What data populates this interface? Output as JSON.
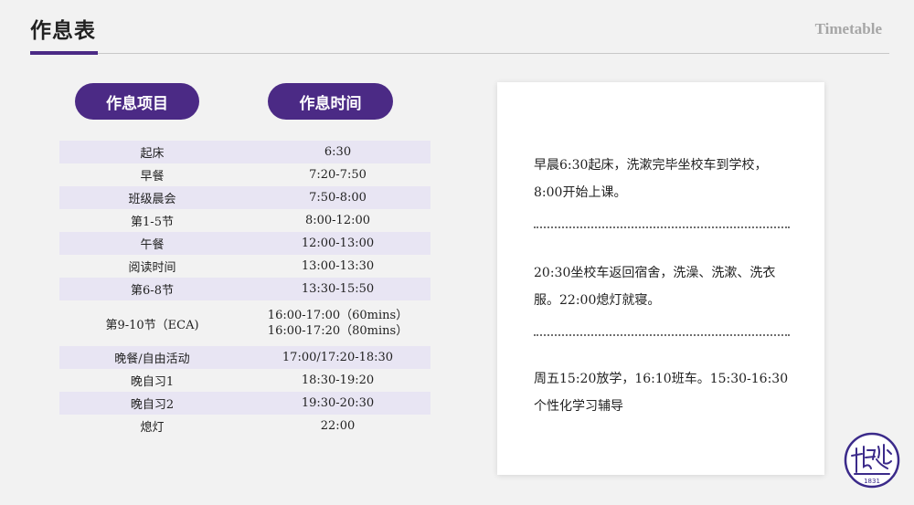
{
  "header": {
    "title": "作息表",
    "subtitle": "Timetable"
  },
  "columns": {
    "item": "作息项目",
    "time": "作息时间"
  },
  "schedule": [
    {
      "item": "起床",
      "time": "6:30"
    },
    {
      "item": "早餐",
      "time": "7:20-7:50"
    },
    {
      "item": "班级晨会",
      "time": "7:50-8:00"
    },
    {
      "item": "第1-5节",
      "time": "8:00-12:00"
    },
    {
      "item": "午餐",
      "time": "12:00-13:00"
    },
    {
      "item": "阅读时间",
      "time": "13:00-13:30"
    },
    {
      "item": "第6-8节",
      "time": "13:30-15:50"
    },
    {
      "item": "第9-10节（ECA)",
      "time": "16:00-17:00（60mins）",
      "time2": "16:00-17:20（80mins）"
    },
    {
      "item": "晚餐/自由活动",
      "time": "17:00/17:20-18:30"
    },
    {
      "item": "晚自习1",
      "time": "18:30-19:20"
    },
    {
      "item": "晚自习2",
      "time": "19:30-20:30"
    },
    {
      "item": "熄灯",
      "time": "22:00"
    }
  ],
  "notes": [
    "早晨6:30起床，洗漱完毕坐校车到学校，8:00开始上课。",
    "20:30坐校车返回宿舍，洗澡、洗漱、洗衣服。22:00熄灯就寝。",
    "周五15:20放学，16:10班车。15:30-16:30 个性化学习辅导"
  ],
  "logo": {
    "text": "梅沙 1831"
  },
  "colors": {
    "accent": "#4b2a85",
    "row_shade": "#e8e5f3",
    "background": "#f2f2f2"
  }
}
